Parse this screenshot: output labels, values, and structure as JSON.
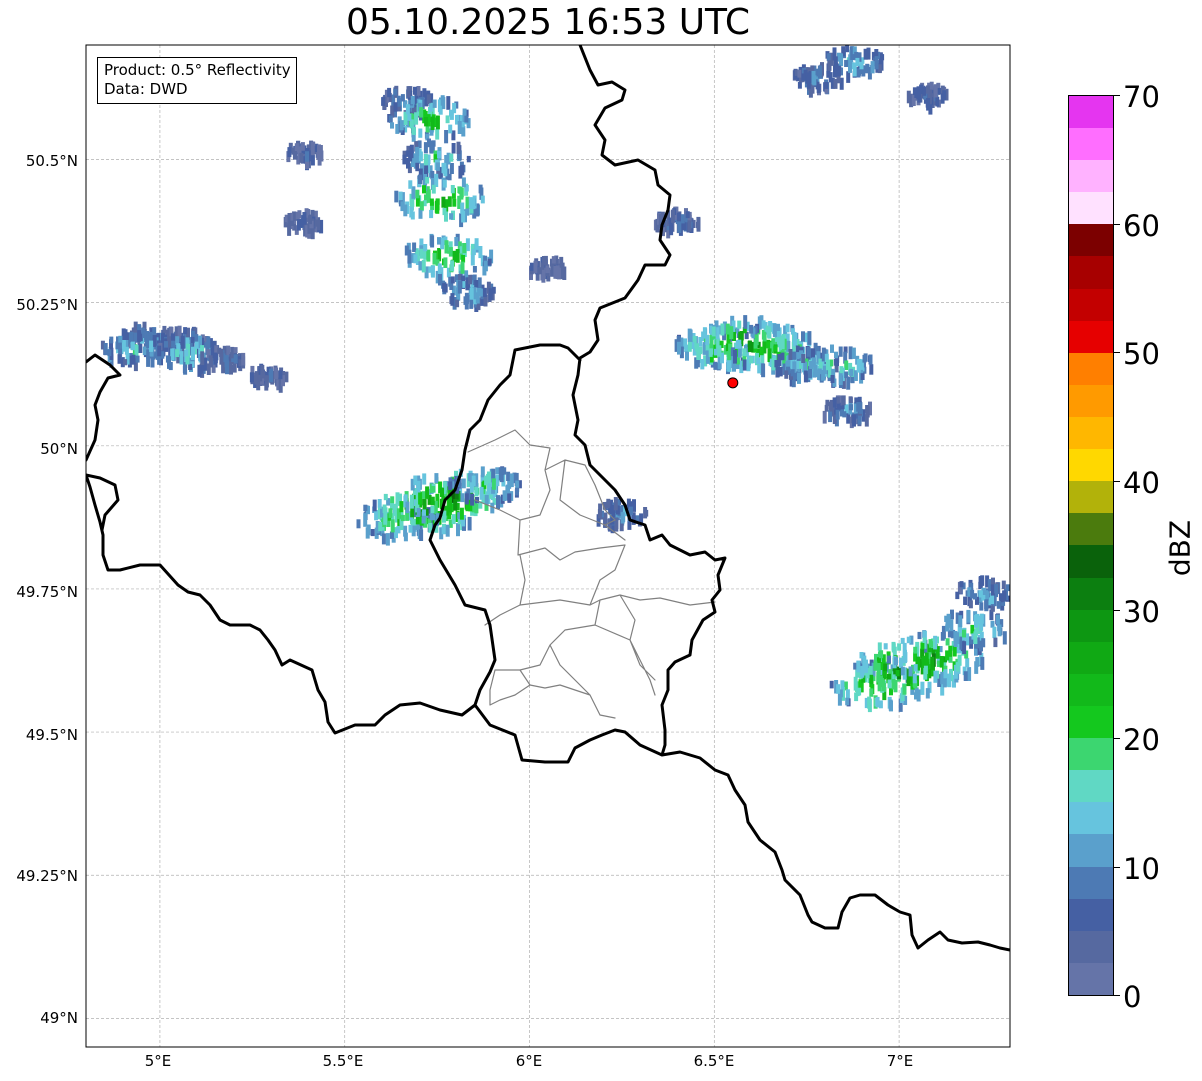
{
  "title": "05.10.2025 16:53 UTC",
  "info_box": {
    "product": "Product: 0.5° Reflectivity",
    "data": "Data: DWD"
  },
  "lat_labels": [
    "50.5°N",
    "50.25°N",
    "50°N",
    "49.75°N",
    "49.5°N",
    "49.25°N",
    "49°N"
  ],
  "lon_labels": [
    "5°E",
    "5.5°E",
    "6°E",
    "6.5°E",
    "7°E"
  ],
  "map_data": {
    "extent_lon": [
      4.8,
      7.3
    ],
    "extent_lat": [
      48.95,
      50.7
    ],
    "lat_gridlines": [
      50.5,
      50.25,
      50.0,
      49.75,
      49.5,
      49.25,
      49.0
    ],
    "lon_gridlines": [
      5.0,
      5.5,
      6.0,
      6.5,
      7.0
    ],
    "radar_site": {
      "lon": 6.55,
      "lat": 50.11,
      "color": "#ff0000"
    },
    "echo_cells": [
      {
        "lon": 4.97,
        "lat": 50.19,
        "dbz": 12
      },
      {
        "lon": 4.93,
        "lat": 50.17,
        "dbz": 17
      },
      {
        "lon": 5.06,
        "lat": 50.18,
        "dbz": 11
      },
      {
        "lon": 5.08,
        "lat": 50.16,
        "dbz": 18
      },
      {
        "lon": 5.17,
        "lat": 50.15,
        "dbz": 9
      },
      {
        "lon": 5.29,
        "lat": 50.12,
        "dbz": 7
      },
      {
        "lon": 5.67,
        "lat": 50.6,
        "dbz": 12
      },
      {
        "lon": 5.73,
        "lat": 50.57,
        "dbz": 24
      },
      {
        "lon": 5.75,
        "lat": 50.5,
        "dbz": 18
      },
      {
        "lon": 5.76,
        "lat": 50.43,
        "dbz": 27
      },
      {
        "lon": 5.78,
        "lat": 50.33,
        "dbz": 26
      },
      {
        "lon": 5.83,
        "lat": 50.27,
        "dbz": 14
      },
      {
        "lon": 5.39,
        "lat": 50.39,
        "dbz": 6
      },
      {
        "lon": 5.39,
        "lat": 50.51,
        "dbz": 6
      },
      {
        "lon": 6.05,
        "lat": 50.31,
        "dbz": 6
      },
      {
        "lon": 6.4,
        "lat": 50.39,
        "dbz": 9
      },
      {
        "lon": 6.78,
        "lat": 50.64,
        "dbz": 11
      },
      {
        "lon": 6.88,
        "lat": 50.67,
        "dbz": 15
      },
      {
        "lon": 7.08,
        "lat": 50.61,
        "dbz": 7
      },
      {
        "lon": 5.64,
        "lat": 49.87,
        "dbz": 22
      },
      {
        "lon": 5.72,
        "lat": 49.89,
        "dbz": 32
      },
      {
        "lon": 5.79,
        "lat": 49.91,
        "dbz": 31
      },
      {
        "lon": 5.88,
        "lat": 49.93,
        "dbz": 20
      },
      {
        "lon": 6.25,
        "lat": 49.88,
        "dbz": 12
      },
      {
        "lon": 6.5,
        "lat": 50.17,
        "dbz": 23
      },
      {
        "lon": 6.59,
        "lat": 50.18,
        "dbz": 30
      },
      {
        "lon": 6.66,
        "lat": 50.17,
        "dbz": 26
      },
      {
        "lon": 6.75,
        "lat": 50.14,
        "dbz": 17
      },
      {
        "lon": 6.83,
        "lat": 50.14,
        "dbz": 20
      },
      {
        "lon": 6.86,
        "lat": 50.06,
        "dbz": 11
      },
      {
        "lon": 6.94,
        "lat": 49.58,
        "dbz": 27
      },
      {
        "lon": 7.02,
        "lat": 49.61,
        "dbz": 33
      },
      {
        "lon": 7.1,
        "lat": 49.63,
        "dbz": 29
      },
      {
        "lon": 7.2,
        "lat": 49.68,
        "dbz": 20
      },
      {
        "lon": 7.23,
        "lat": 49.74,
        "dbz": 14
      }
    ]
  },
  "colorbar": {
    "label": "dBZ",
    "min": 0,
    "max": 70,
    "ticks": [
      "0",
      "10",
      "20",
      "30",
      "40",
      "50",
      "60",
      "70"
    ],
    "colors": [
      "#6574a8",
      "#5669a0",
      "#4560a3",
      "#4d7ab4",
      "#5aa0cc",
      "#66c4de",
      "#60d8c4",
      "#3cd670",
      "#14c81e",
      "#12b91a",
      "#10a914",
      "#0d9712",
      "#0c7f10",
      "#0a620b",
      "#4b7b0d",
      "#b2b20a",
      "#ffd800",
      "#ffb700",
      "#ff9a00",
      "#ff7f00",
      "#e60000",
      "#c30000",
      "#a70000",
      "#7c0000",
      "#ffe1ff",
      "#ffb2ff",
      "#ff6eff",
      "#e535f0"
    ]
  }
}
